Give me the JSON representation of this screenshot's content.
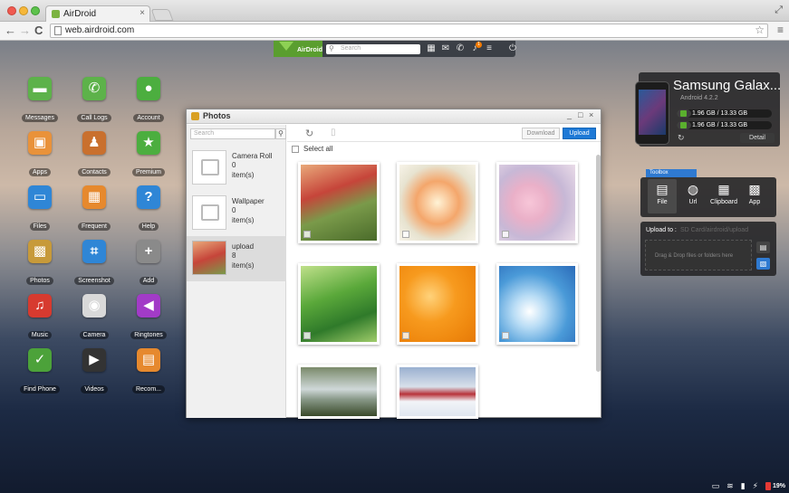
{
  "browser": {
    "tab_title": "AirDroid",
    "tab_close": "×",
    "url": "web.airdroid.com",
    "back": "←",
    "forward": "→",
    "reload": "C",
    "star": "☆",
    "menu": "≡",
    "fullscreen": "⤢"
  },
  "airdroid_bar": {
    "logo_text": "AirDroid",
    "search_placeholder": "Search",
    "icons": [
      "apps-grid-icon",
      "mail-icon",
      "phone-icon",
      "notification-icon",
      "menu-icon",
      "power-icon"
    ],
    "notification_count": "1"
  },
  "desktop_icons": [
    {
      "label": "Messages",
      "color": "#5db24a",
      "glyph": "▬"
    },
    {
      "label": "Call Logs",
      "color": "#5db24a",
      "glyph": "✆"
    },
    {
      "label": "Account",
      "color": "#4cae3f",
      "glyph": "●"
    },
    {
      "label": "Apps",
      "color": "#e9923a",
      "glyph": "▣"
    },
    {
      "label": "Contacts",
      "color": "#c9702e",
      "glyph": "♟"
    },
    {
      "label": "Premium",
      "color": "#4cae3f",
      "glyph": "★"
    },
    {
      "label": "Files",
      "color": "#2f86d6",
      "glyph": "▭"
    },
    {
      "label": "Frequent",
      "color": "#e6892e",
      "glyph": "▦"
    },
    {
      "label": "Help",
      "color": "#2f86d6",
      "glyph": "?"
    },
    {
      "label": "Photos",
      "color": "#c79a3a",
      "glyph": "▩"
    },
    {
      "label": "Screenshot",
      "color": "#2f86d6",
      "glyph": "⌗"
    },
    {
      "label": "Add",
      "color": "#8a8a8a",
      "glyph": "+"
    },
    {
      "label": "Music",
      "color": "#d73a2f",
      "glyph": "♫"
    },
    {
      "label": "Camera",
      "color": "#d9d9d9",
      "glyph": "◉"
    },
    {
      "label": "Ringtones",
      "color": "#a23bc7",
      "glyph": "◀"
    },
    {
      "label": "Find Phone",
      "color": "#4ca23a",
      "glyph": "✓"
    },
    {
      "label": "Videos",
      "color": "#333333",
      "glyph": "▶"
    },
    {
      "label": "Recom...",
      "color": "#e6892e",
      "glyph": "▤"
    }
  ],
  "photos_window": {
    "title": "Photos",
    "minimize": "_",
    "maximize": "□",
    "close": "×",
    "search_placeholder": "Search",
    "search_btn": "⚲",
    "albums": [
      {
        "name": "Camera Roll",
        "count": "0",
        "unit": "item(s)"
      },
      {
        "name": "Wallpaper",
        "count": "0",
        "unit": "item(s)"
      },
      {
        "name": "upload",
        "count": "8",
        "unit": "item(s)"
      }
    ],
    "refresh": "↻",
    "trash": "🗑",
    "download_label": "Download",
    "upload_label": "Upload",
    "select_all": "Select all",
    "photos": [
      {
        "name": "cafe-photo",
        "bg": "linear-gradient(160deg,#e9a97a 0%,#c6453a 35%,#7a9a4a 60%,#4a6b2a 100%)"
      },
      {
        "name": "seafood-photo",
        "bg": "radial-gradient(circle at 50% 50%,#fff3d6 0%,#f4a66b 40%,#e7e3d0 70%,#f7f3e8 100%)"
      },
      {
        "name": "blossom-photo",
        "bg": "radial-gradient(circle at 40% 50%,#f7c6d8 0%,#eab0c8 30%,#c7b8d6 60%,#eadce8 100%)"
      },
      {
        "name": "grass-photo",
        "bg": "linear-gradient(160deg,#bfe08a 0%,#5aa83a 40%,#2f7a2a 70%,#9fcc6a 100%)"
      },
      {
        "name": "orange-photo",
        "bg": "radial-gradient(circle at 40% 40%,#ffd27a 0%,#f79a1e 40%,#f08a10 70%,#e67a08 100%)"
      },
      {
        "name": "flowers-sky-photo",
        "bg": "radial-gradient(circle at 40% 60%,#ffffff 0%,#b8dcf5 25%,#4a9ad8 60%,#2a6ab8 100%)"
      },
      {
        "name": "stream-photo",
        "bg": "linear-gradient(180deg,#7a8a6a 0%,#cfd8d8 45%,#8a9a8a 65%,#3a4a2a 100%)"
      },
      {
        "name": "snow-house-photo",
        "bg": "linear-gradient(180deg,#9ab0d0 0%,#d8e0ea 40%,#b8343a 55%,#f2f4f8 70%,#dfe6ef 100%)"
      }
    ]
  },
  "device": {
    "name": "Samsung Galax...",
    "os": "Android 4.2.2",
    "storage": [
      {
        "text": "1.96 GB / 13.33 GB",
        "fraction": 0.15
      },
      {
        "text": "1.96 GB / 13.33 GB",
        "fraction": 0.15
      }
    ],
    "refresh": "↻",
    "detail_label": "Detail"
  },
  "toolbox": {
    "tab_label": "Toolbox",
    "items": [
      {
        "label": "File",
        "glyph": "▤"
      },
      {
        "label": "Url",
        "glyph": "◍"
      },
      {
        "label": "Clipboard",
        "glyph": "▦"
      },
      {
        "label": "App",
        "glyph": "▩"
      }
    ],
    "upload_to_label": "Upload to :",
    "upload_path": "SD Card/airdroid/upload",
    "drop_text": "Drag & Drop files or folders here"
  },
  "statusbar": {
    "battery": "19%"
  }
}
